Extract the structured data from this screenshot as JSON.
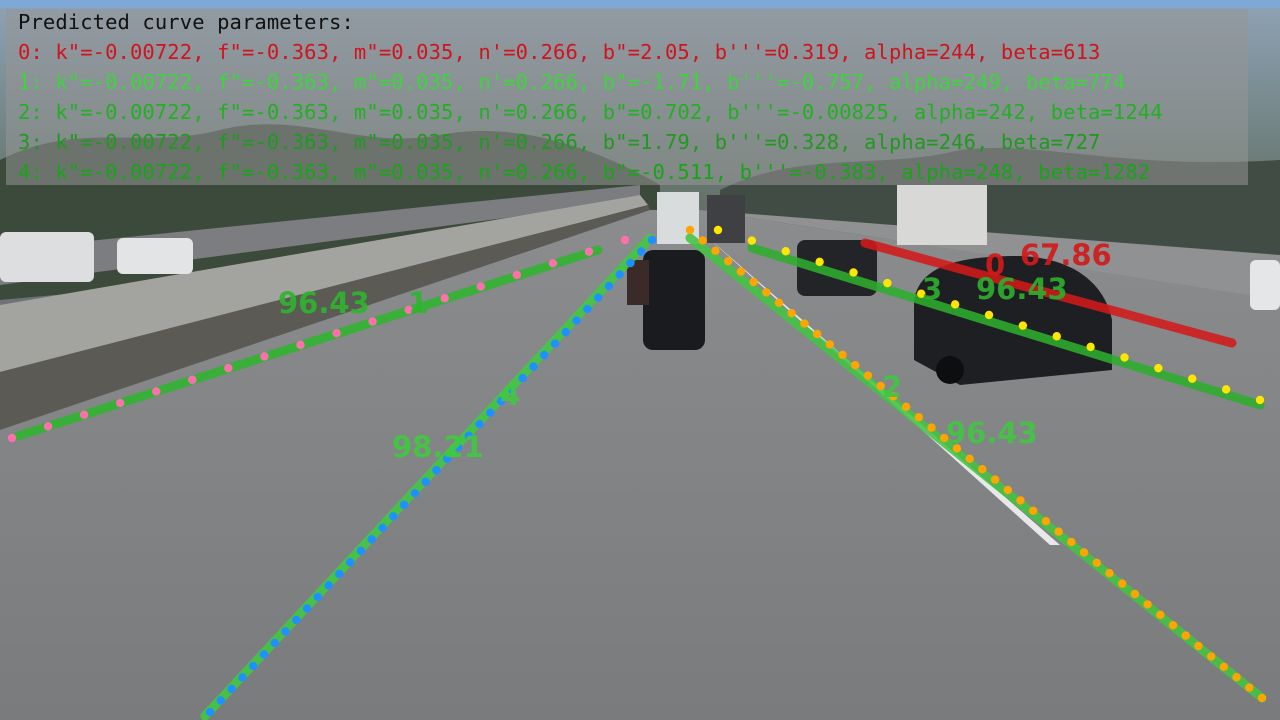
{
  "overlay": {
    "title": "Predicted curve parameters:",
    "lines": [
      {
        "text": "0: k\"=-0.00722, f\"=-0.363, m\"=0.035, n'=0.266, b\"=2.05, b'''=0.319, alpha=244, beta=613",
        "color": "#d0141f"
      },
      {
        "text": "1: k\"=-0.00722, f\"=-0.363, m\"=0.035, n'=0.266, b\"=-1.71, b'''=-0.757, alpha=249, beta=774",
        "color": "#3ed43e"
      },
      {
        "text": "2: k\"=-0.00722, f\"=-0.363, m\"=0.035, n'=0.266, b\"=0.702, b'''=-0.00825, alpha=242, beta=1244",
        "color": "#22b022"
      },
      {
        "text": "3: k\"=-0.00722, f\"=-0.363, m\"=0.035, n'=0.266, b\"=1.79, b'''=0.328, alpha=246, beta=727",
        "color": "#1f9a1f"
      },
      {
        "text": "4: k\"=-0.00722, f\"=-0.363, m\"=0.035, n'=0.266, b\"=-0.511, b'''=-0.383, alpha=248, beta=1282",
        "color": "#17a517"
      }
    ]
  },
  "lanes": [
    {
      "id": "0",
      "confidence": "67.86",
      "color": "#d21a1a"
    },
    {
      "id": "1",
      "confidence": "96.43",
      "color": "#2fb52f"
    },
    {
      "id": "2",
      "confidence": "96.43",
      "color": "#43c443"
    },
    {
      "id": "3",
      "confidence": "96.43",
      "color": "#2eae2e"
    },
    {
      "id": "4",
      "confidence": "98.21",
      "color": "#41c941"
    }
  ],
  "colors": {
    "gt_left": "#ff6fb0",
    "gt_center": "#1e90ff",
    "gt_right": "#ffa500",
    "gt_far_right": "#ffe600"
  }
}
